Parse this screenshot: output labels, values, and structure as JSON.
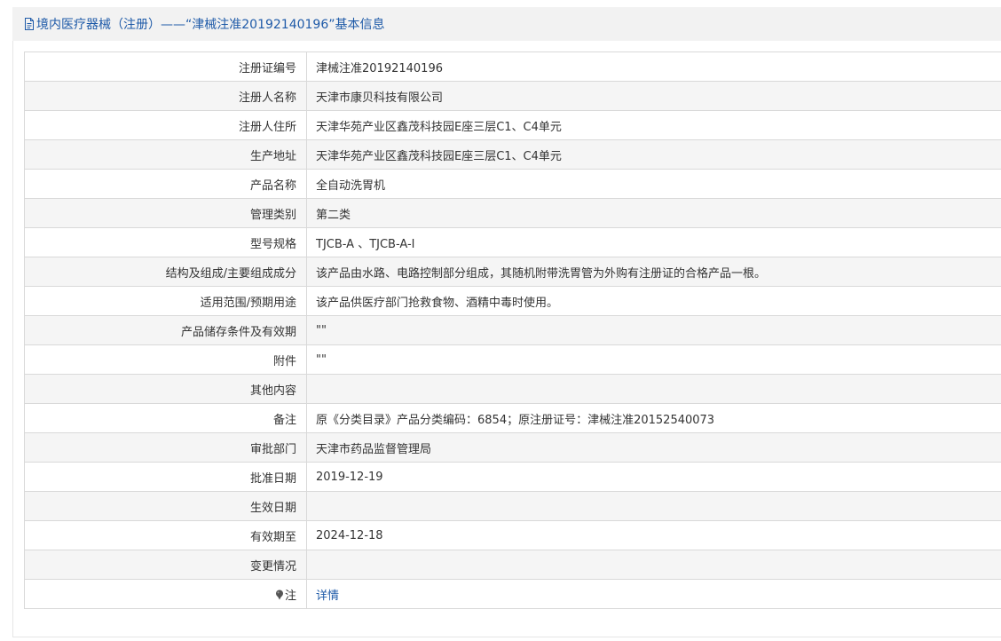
{
  "header": {
    "title": "境内医疗器械（注册）——“津械注准20192140196”基本信息",
    "icon": "document-icon",
    "color": "#1e5aa8"
  },
  "rows": [
    {
      "label": "注册证编号",
      "value": "津械注准20192140196"
    },
    {
      "label": "注册人名称",
      "value": "天津市康贝科技有限公司"
    },
    {
      "label": "注册人住所",
      "value": "天津华苑产业区鑫茂科技园E座三层C1、C4单元"
    },
    {
      "label": "生产地址",
      "value": "天津华苑产业区鑫茂科技园E座三层C1、C4单元"
    },
    {
      "label": "产品名称",
      "value": "全自动洗胃机"
    },
    {
      "label": "管理类别",
      "value": "第二类"
    },
    {
      "label": "型号规格",
      "value": "TJCB-A 、TJCB-A-I"
    },
    {
      "label": "结构及组成/主要组成成分",
      "value": "该产品由水路、电路控制部分组成，其随机附带洗胃管为外购有注册证的合格产品一根。"
    },
    {
      "label": "适用范围/预期用途",
      "value": "该产品供医疗部门抢救食物、酒精中毒时使用。"
    },
    {
      "label": "产品储存条件及有效期",
      "value": "\"\""
    },
    {
      "label": "附件",
      "value": "\"\""
    },
    {
      "label": "其他内容",
      "value": ""
    },
    {
      "label": "备注",
      "value": "原《分类目录》产品分类编码：6854；原注册证号：津械注准20152540073"
    },
    {
      "label": "审批部门",
      "value": "天津市药品监督管理局"
    },
    {
      "label": "批准日期",
      "value": "2019-12-19"
    },
    {
      "label": "生效日期",
      "value": ""
    },
    {
      "label": "有效期至",
      "value": "2024-12-18"
    },
    {
      "label": "变更情况",
      "value": ""
    }
  ],
  "note_row": {
    "label": "注",
    "icon": "pin-icon",
    "link_text": "详情"
  }
}
